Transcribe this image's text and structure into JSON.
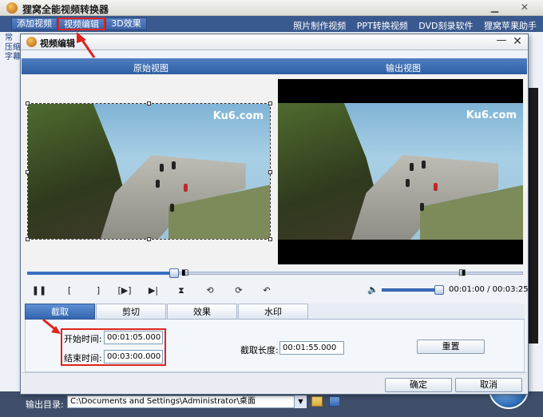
{
  "app": {
    "title": "狸窝全能视频转换器",
    "toolbar": [
      "添加视频",
      "视频编辑",
      "3D效果"
    ],
    "top_links": [
      "照片制作视频",
      "PPT转换视频",
      "DVD刻录软件",
      "狸窝苹果助手"
    ],
    "left_items": [
      "常",
      "压缩",
      "字幕"
    ],
    "output_label": "输出目录:",
    "output_path": "C:\\Documents and Settings\\Administrator\\桌面"
  },
  "dialog": {
    "title": "视频编辑",
    "close_glyph": "✕",
    "min_glyph": "—",
    "original_view": "原始视图",
    "output_view": "输出视图",
    "watermark": "Ku6.com",
    "time_current": "00:01:00",
    "time_total": "00:03:25",
    "time_separator": " / ",
    "controls": [
      {
        "name": "pause-icon",
        "glyph": "❚❚"
      },
      {
        "name": "mark-start-icon",
        "glyph": "["
      },
      {
        "name": "mark-end-icon",
        "glyph": "]"
      },
      {
        "name": "step-forward-icon",
        "glyph": "[▶]"
      },
      {
        "name": "skip-forward-icon",
        "glyph": "▶|"
      },
      {
        "name": "split-icon",
        "glyph": "⧗"
      },
      {
        "name": "rotate-left-icon",
        "glyph": "⟲"
      },
      {
        "name": "rotate-right-icon",
        "glyph": "⟳"
      },
      {
        "name": "undo-icon",
        "glyph": "↶"
      }
    ],
    "volume_icon": "🔈",
    "tabs": [
      "截取",
      "剪切",
      "效果",
      "水印"
    ],
    "start_label": "开始时间:",
    "start_value": "00:01:05.000",
    "end_label": "结束时间:",
    "end_value": "00:03:00.000",
    "length_label": "截取长度:",
    "length_value": "00:01:55.000",
    "reset": "重置",
    "ok": "确定",
    "cancel": "取消"
  },
  "colors": {
    "accent": "#3264ae",
    "annotation": "#e0231d"
  }
}
